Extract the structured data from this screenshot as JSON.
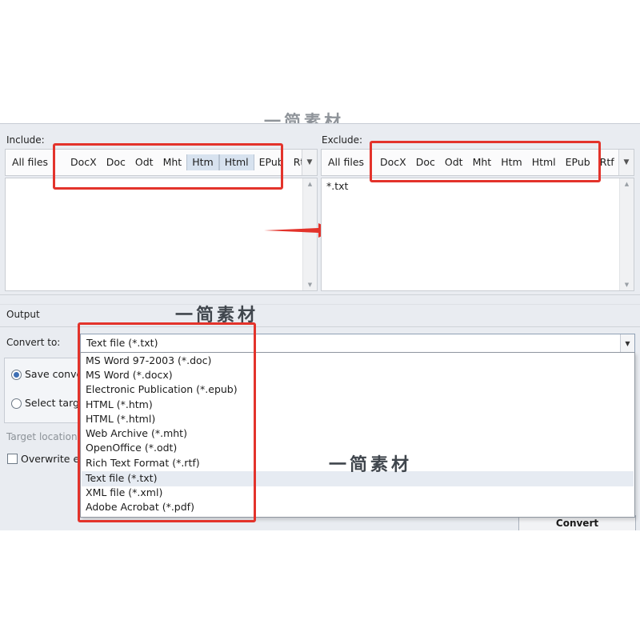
{
  "watermark": "一简素材",
  "include": {
    "label": "Include:",
    "tabs": [
      "All files",
      "DocX",
      "Doc",
      "Odt",
      "Mht",
      "Htm",
      "Html",
      "EPub",
      "Rtf"
    ],
    "selected_tabs": [
      "Htm",
      "Html"
    ],
    "entries": []
  },
  "exclude": {
    "label": "Exclude:",
    "tabs": [
      "All files",
      "DocX",
      "Doc",
      "Odt",
      "Mht",
      "Htm",
      "Html",
      "EPub",
      "Rtf"
    ],
    "entries": [
      "*.txt"
    ]
  },
  "output": {
    "section_title": "Output",
    "convert_to_label": "Convert to:",
    "convert_to_value": "Text file (*.txt)",
    "options": [
      "MS Word 97-2003 (*.doc)",
      "MS Word (*.docx)",
      "Electronic Publication (*.epub)",
      "HTML (*.htm)",
      "HTML (*.html)",
      "Web Archive (*.mht)",
      "OpenOffice (*.odt)",
      "Rich Text Format (*.rtf)",
      "Text file (*.txt)",
      "XML file (*.xml)",
      "Adobe Acrobat (*.pdf)"
    ],
    "highlighted_option": "Text file (*.txt)",
    "radio_save": "Save convert",
    "radio_select": "Select target",
    "target_location_label": "Target location:",
    "overwrite_label": "Overwrite exi",
    "convert_button": "Convert"
  },
  "colors": {
    "annotation": "#e3332b",
    "panel_bg": "#e9ecf1",
    "selected_tab": "#d7e2ef"
  }
}
